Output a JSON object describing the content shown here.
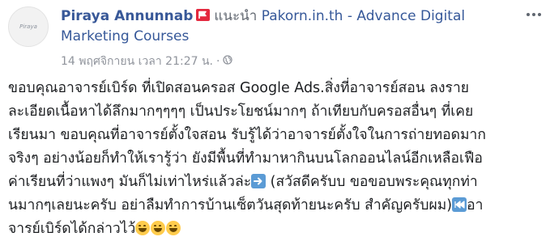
{
  "post": {
    "avatar_text": "Piraya",
    "author": "Piraya Annunnab",
    "recommends": "แนะนำ",
    "page": "Pakorn.in.th - Advance Digital Marketing Courses",
    "timestamp": "14 พฤศจิกายน เวลา 21:27 น.",
    "separator": "·",
    "body_lines": [
      "ขอบคุณอาจารย์เบิร์ด ที่เปิดสอนครอส Google Ads.สิ่งที่อาจารย์สอน ลงราย",
      "ละเอียดเนื้อหาได้ลึกมากๆๆๆๆ เป็นประโยชน์มากๆ ถ้าเทียบกับครอสอื่นๆ ที่เคย",
      "เรียนมา ขอบคุณที่อาจารย์ตั้งใจสอน รับรู้ได้ว่าอาจารย์ตั้งใจในการถ่ายทอดมาก",
      "จริงๆ อย่างน้อยก็ทำให้เรารู้ว่า ยังมีพื้นที่ทำมาหากินบนโลกออนไลน์อีกเหลือเฟือ"
    ],
    "line5_a": "ค่าเรียนที่ว่าแพงๆ มันก็ไม่เท่าไหร่แล้วล่ะ",
    "line5_b": " (สวัสดีครับบ ขอขอบพระคุณทุกท่า",
    "line6_a": "นมากๆเลยนะครับ อย่าลืมทำการบ้านเซ็ตวันสุดท้ายนะครับ สำคัญครับผม)",
    "line6_b": "อา",
    "line7": "จารย์เบิร์ดได้กล่าวไว้"
  },
  "icons": {
    "badge": "recommend-flag-icon",
    "privacy": "globe-icon",
    "more": "more-options-icon",
    "arrow": "right-arrow-emoji",
    "rewind": "rewind-emoji",
    "laugh": "tears-of-joy-emoji"
  },
  "colors": {
    "link": "#365899",
    "muted": "#90949c",
    "text": "#1c1e21",
    "badge": "#e4293f",
    "emoji_box": "#5b9bd5",
    "emoji_face": "#ffcc4d"
  }
}
